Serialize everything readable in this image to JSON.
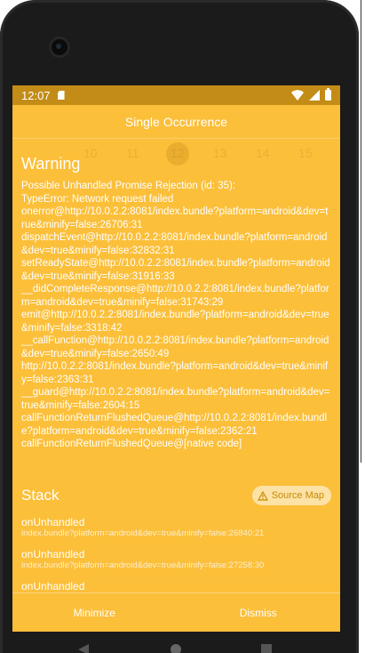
{
  "status_bar": {
    "time": "12:07"
  },
  "app": {
    "header_title": "Single Occurrence",
    "ghost_days": [
      "10",
      "11",
      "12",
      "13",
      "14",
      "15"
    ]
  },
  "warning": {
    "title": "Warning",
    "message": "Possible Unhandled Promise Rejection (id: 35):\nTypeError: Network request failed\nonerror@http://10.0.2.2:8081/index.bundle?platform=android&dev=true&minify=false:26706:31\ndispatchEvent@http://10.0.2.2:8081/index.bundle?platform=android&dev=true&minify=false:32832:31\nsetReadyState@http://10.0.2.2:8081/index.bundle?platform=android&dev=true&minify=false:31916:33\n__didCompleteResponse@http://10.0.2.2:8081/index.bundle?platform=android&dev=true&minify=false:31743:29\nemit@http://10.0.2.2:8081/index.bundle?platform=android&dev=true&minify=false:3318:42\n__callFunction@http://10.0.2.2:8081/index.bundle?platform=android&dev=true&minify=false:2650:49\nhttp://10.0.2.2:8081/index.bundle?platform=android&dev=true&minify=false:2363:31\n__guard@http://10.0.2.2:8081/index.bundle?platform=android&dev=true&minify=false:2604:15\ncallFunctionReturnFlushedQueue@http://10.0.2.2:8081/index.bundle?platform=android&dev=true&minify=false:2362:21\ncallFunctionReturnFlushedQueue@[native code]"
  },
  "stack": {
    "title": "Stack",
    "source_map_label": "Source Map",
    "frames": [
      {
        "name": "onUnhandled",
        "file": "index.bundle?platform=android&dev=true&minify=false:26840:21"
      },
      {
        "name": "onUnhandled",
        "file": "index.bundle?platform=android&dev=true&minify=false:27258:30"
      },
      {
        "name": "onUnhandled",
        "file": ""
      }
    ]
  },
  "actions": {
    "minimize_label": "Minimize",
    "dismiss_label": "Dismiss"
  },
  "colors": {
    "warning_background": "#fbbf3a",
    "status_bar": "#c38c16"
  },
  "icons": {
    "status_bar": [
      "sd-card-icon",
      "wifi-icon",
      "signal-icon",
      "battery-icon"
    ],
    "source_map": "warning-triangle-icon"
  }
}
